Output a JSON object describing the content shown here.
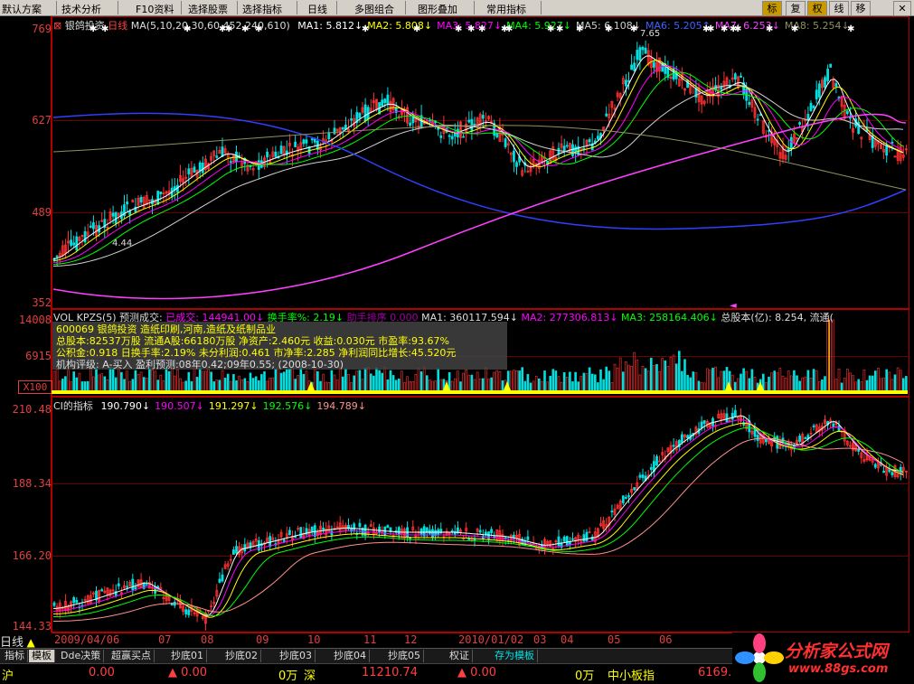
{
  "menu": {
    "default_plan": "默认方案",
    "tech_analysis": "技术分析",
    "f10": "F10资料",
    "select_stock": "选择股票",
    "select_indicator": "选择指标",
    "daily": "日线",
    "multi_combo": "多图组合",
    "overlay": "图形叠加",
    "common_indicators": "常用指标"
  },
  "toolbar_buttons": [
    "标",
    "复",
    "权",
    "线",
    "移"
  ],
  "close_glyph": "✕",
  "main_chart": {
    "stock_name": "银鸽投资",
    "period": "日线",
    "ma_params": "MA(5,10,20,30,60,452,240,610)",
    "ma_values": [
      {
        "label": "MA1:",
        "value": "5.812↓",
        "color": "#ffffff"
      },
      {
        "label": "MA2:",
        "value": "5.808↓",
        "color": "#ffff00"
      },
      {
        "label": "MA3:",
        "value": "5.827↓",
        "color": "#ff00ff"
      },
      {
        "label": "MA4:",
        "value": "5.927↓",
        "color": "#00ff00"
      },
      {
        "label": "MA5:",
        "value": "6.108↓",
        "color": "#d0d0d0"
      },
      {
        "label": "MA6:",
        "value": "5.205↑",
        "color": "#4060ff"
      },
      {
        "label": "MA7:",
        "value": "6.253↓",
        "color": "#ff40ff"
      },
      {
        "label": "MA8:",
        "value": "5.254↓",
        "color": "#909060"
      }
    ],
    "y_ticks": [
      "769",
      "627",
      "489",
      "352"
    ],
    "high_label": "7.65",
    "low_label": "4.44"
  },
  "volume_panel": {
    "header": "VOL KPZS(5)",
    "predict_label": "预测成交:",
    "traded_label": "已成交:",
    "traded_value": "144941.00↓",
    "turnover_label": "换手率%:",
    "turnover_value": "2.19↓",
    "assist_label": "助手排序",
    "assist_value": "0.000",
    "vma1": "MA1: 360117.594↓",
    "vma2": "MA2: 277306.813↓",
    "vma3": "MA3: 258164.406↓",
    "total_shares": "总股本(亿): 8.254, 流通(",
    "y_ticks": [
      "14008",
      "6915",
      "X100"
    ],
    "info_lines": [
      "600069 银鸽投资 造纸印刷,河南,造纸及纸制品业",
      "总股本:82537万股 流通A股:66180万股 净资产:2.460元  收益:0.030元  市盈率:93.67%",
      "公积金:0.918  日换手率:2.19%  未分利润:0.461  市净率:2.285  净利润同比增长:45.520元",
      "机构评级: A-买入 盈利预测:08年0.42;09年0.55; (2008-10-30)"
    ]
  },
  "ci_panel": {
    "name": "CI的指标",
    "values": [
      {
        "value": "190.790↓",
        "color": "#ffffff"
      },
      {
        "value": "190.507↓",
        "color": "#ff00ff"
      },
      {
        "value": "191.297↓",
        "color": "#ffff00"
      },
      {
        "value": "192.576↓",
        "color": "#00ff00"
      },
      {
        "value": "194.789↓",
        "color": "#ff9090"
      }
    ],
    "y_ticks": [
      "210.48",
      "188.34",
      "166.20",
      "144.33"
    ]
  },
  "date_axis": {
    "period_label": "日线",
    "labels": [
      "2009/04/06",
      "07",
      "08",
      "09",
      "10",
      "11",
      "12",
      "2010/01/02",
      "03",
      "04",
      "05",
      "06"
    ]
  },
  "tabs": [
    "指标",
    "模板",
    "Dde决策",
    "超赢买点",
    "抄底01",
    "抄底02",
    "抄底03",
    "抄底04",
    "抄底05",
    "权证",
    "存为模板"
  ],
  "selected_tab": "模板",
  "status": {
    "sh_label": "沪",
    "sh_value": "0.00",
    "sh_change": "▲ 0.00",
    "sh_amount": "0万",
    "sz_label": "深",
    "sz_value": "11210.74",
    "sz_change": "▲ 0.00",
    "sz_amount": "0万",
    "sme_label": "中小板指",
    "sme_value": "6169."
  },
  "logo": {
    "title": "分析家公式网",
    "url": "www.88gs.com"
  },
  "colors": {
    "up": "#ff3030",
    "down": "#00e0e0",
    "axis": "#e04040",
    "grid": "#6a0000"
  }
}
